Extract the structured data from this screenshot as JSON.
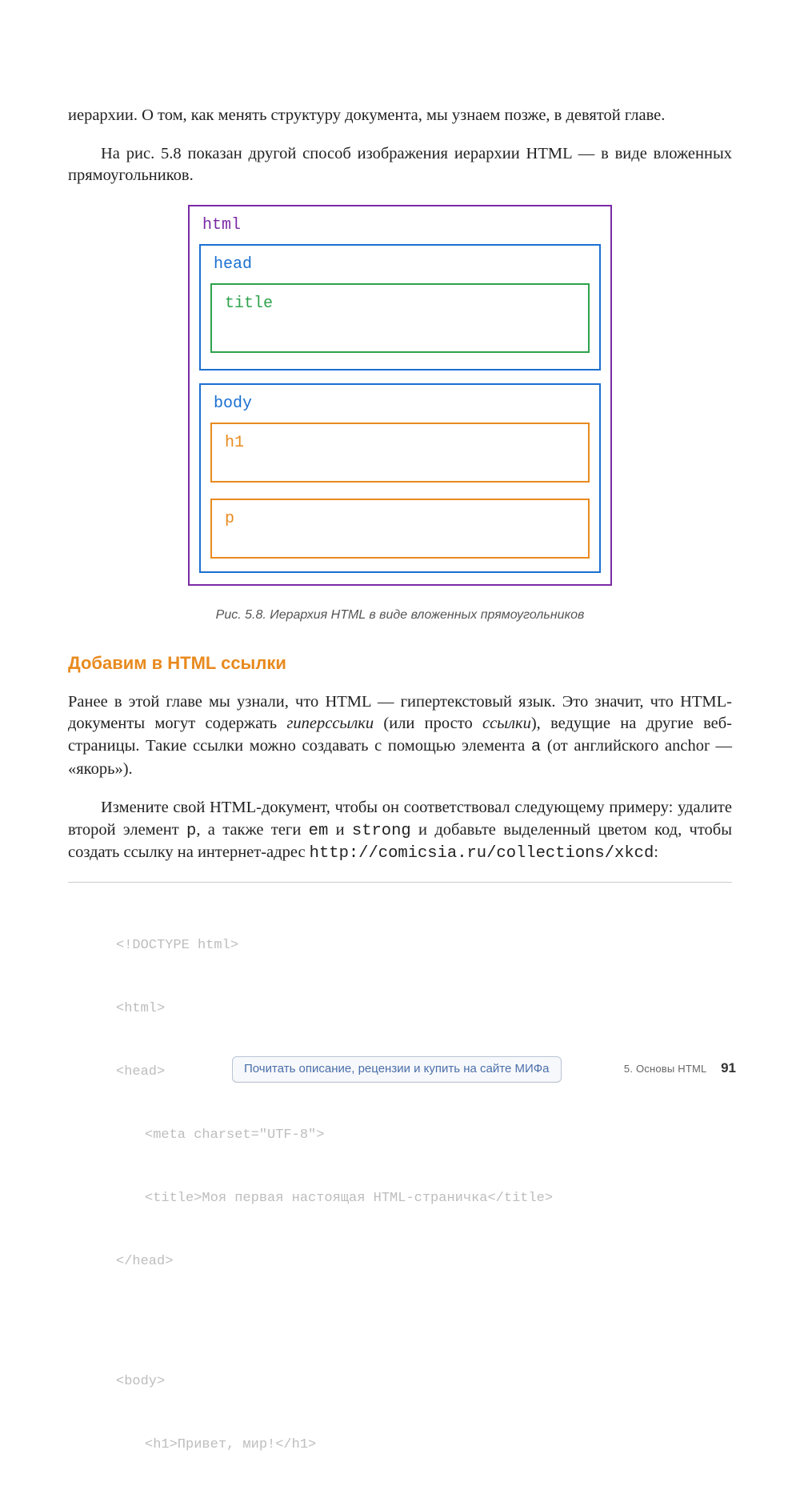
{
  "intro": {
    "p1": "иерархии. О том, как менять структуру документа, мы узнаем позже, в девятой главе.",
    "p2": "На рис. 5.8 показан другой способ изображения иерархии HTML — в виде вложенных прямоугольников."
  },
  "figure": {
    "labels": {
      "html": "html",
      "head": "head",
      "title": "title",
      "body": "body",
      "h1": "h1",
      "p": "p"
    },
    "caption": "Рис. 5.8. Иерархия HTML в виде вложенных прямоугольников"
  },
  "section": {
    "title": "Добавим в HTML ссылки",
    "p1_a": "Ранее в этой главе мы узнали, что HTML — гипертекстовый язык. Это значит, что HTML-документы могут содержать ",
    "p1_hyper": "гиперссылки",
    "p1_b": " (или просто ",
    "p1_links": "ссылки",
    "p1_c": "), ведущие на другие веб-страницы. Такие ссылки можно создавать с помощью элемента ",
    "p1_a_tag": "a",
    "p1_d": " (от английского anchor — «якорь»).",
    "p2_a": "Измените свой HTML-документ, чтобы он соответствовал следующему примеру: удалите второй элемент ",
    "p2_p": "p",
    "p2_b": ", а также теги ",
    "p2_em": "em",
    "p2_c": " и ",
    "p2_strong": "strong",
    "p2_d": " и добавьте выделенный цветом код, чтобы создать ссылку на интернет-адрес ",
    "p2_url": "http://comicsia.ru/collections/xkcd",
    "p2_e": ":"
  },
  "code": {
    "l1": "<!DOCTYPE html>",
    "l2": "<html>",
    "l3": "<head>",
    "l4": "<meta charset=\"UTF-8\">",
    "l5": "<title>Моя первая настоящая HTML-страничка</title>",
    "l6": "</head>",
    "l7": "<body>",
    "l8": "<h1>Привет, мир!</h1>"
  },
  "footer": {
    "buy": "Почитать описание, рецензии и купить на сайте МИФа",
    "section": "5. Основы HTML",
    "page": "91"
  }
}
